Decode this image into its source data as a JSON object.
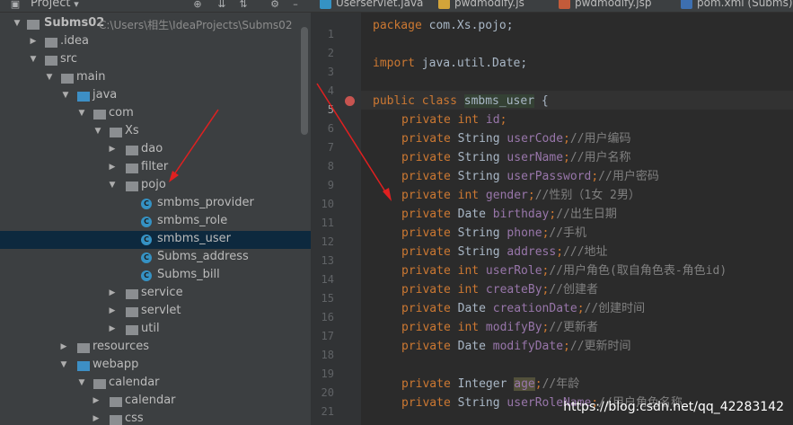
{
  "project_panel": {
    "title": "Project",
    "tree": [
      {
        "label": "Subms02",
        "path": "C:\\Users\\相生\\IdeaProjects\\Subms02",
        "bold": true
      },
      {
        "label": ".idea"
      },
      {
        "label": "src"
      },
      {
        "label": "main"
      },
      {
        "label": "java"
      },
      {
        "label": "com"
      },
      {
        "label": "Xs"
      },
      {
        "label": "dao"
      },
      {
        "label": "filter"
      },
      {
        "label": "pojo"
      },
      {
        "label": "smbms_provider"
      },
      {
        "label": "smbms_role"
      },
      {
        "label": "smbms_user"
      },
      {
        "label": "Subms_address"
      },
      {
        "label": "Subms_bill"
      },
      {
        "label": "service"
      },
      {
        "label": "servlet"
      },
      {
        "label": "util"
      },
      {
        "label": "resources"
      },
      {
        "label": "webapp"
      },
      {
        "label": "calendar"
      },
      {
        "label": "calendar"
      },
      {
        "label": "css"
      }
    ]
  },
  "tabs": [
    {
      "label": "Userservlet.java"
    },
    {
      "label": "pwdmodify.js"
    },
    {
      "label": "pwdmodify.jsp"
    },
    {
      "label": "pom.xml (Subms)"
    }
  ],
  "editor": {
    "line_numbers": [
      "1",
      "2",
      "3",
      "4",
      "5",
      "6",
      "7",
      "8",
      "9",
      "10",
      "11",
      "12",
      "13",
      "14",
      "15",
      "16",
      "17",
      "18",
      "19",
      "20",
      "21",
      "22"
    ],
    "lines": {
      "l1": {
        "kw": "package",
        "rest": " com.Xs.pojo;"
      },
      "l3": {
        "kw": "import",
        "rest": " java.util.Date;"
      },
      "l5": {
        "kw": "public class",
        "name": "smbms_user",
        "rest": " {"
      },
      "l6": {
        "kw": "private int",
        "field": "id",
        "rest": ";"
      },
      "l7": {
        "kw": "private",
        "type": " String ",
        "field": "userCode",
        "rest": ";",
        "comment": "//用户编码"
      },
      "l8": {
        "kw": "private",
        "type": " String ",
        "field": "userName",
        "rest": ";",
        "comment": "//用户名称"
      },
      "l9": {
        "kw": "private",
        "type": " String ",
        "field": "userPassword",
        "rest": ";",
        "comment": "//用户密码"
      },
      "l10": {
        "kw": "private int",
        "type": " ",
        "field": "gender",
        "rest": ";",
        "comment": "//性别（1女 2男）"
      },
      "l11": {
        "kw": "private",
        "type": " Date ",
        "field": "birthday",
        "rest": ";",
        "comment": "//出生日期"
      },
      "l12": {
        "kw": "private",
        "type": " String ",
        "field": "phone",
        "rest": ";",
        "comment": "//手机"
      },
      "l13": {
        "kw": "private",
        "type": " String ",
        "field": "address",
        "rest": ";",
        "comment": "///地址"
      },
      "l14": {
        "kw": "private int",
        "type": " ",
        "field": "userRole",
        "rest": ";",
        "comment": "//用户角色(取自角色表-角色id)"
      },
      "l15": {
        "kw": "private int",
        "type": " ",
        "field": "createBy",
        "rest": ";",
        "comment": "//创建者"
      },
      "l16": {
        "kw": "private",
        "type": " Date ",
        "field": "creationDate",
        "rest": ";",
        "comment": "//创建时间"
      },
      "l17": {
        "kw": "private int",
        "type": " ",
        "field": "modifyBy",
        "rest": ";",
        "comment": "//更新者"
      },
      "l18": {
        "kw": "private",
        "type": " Date ",
        "field": "modifyDate",
        "rest": ";",
        "comment": "//更新时间"
      },
      "l20": {
        "kw": "private",
        "type": " Integer ",
        "field": "age",
        "rest": ";",
        "comment": "//年龄"
      },
      "l21": {
        "kw": "private",
        "type": " String ",
        "field": "userRoleName",
        "rest": ";",
        "comment": "//用户角色名称"
      }
    }
  },
  "watermark": "https://blog.csdn.net/qq_42283142",
  "colors": {
    "keyword": "#cc7832",
    "field": "#9876aa",
    "comment": "#808080",
    "text": "#a9b7c6",
    "annotation_arrow": "#e02020"
  }
}
